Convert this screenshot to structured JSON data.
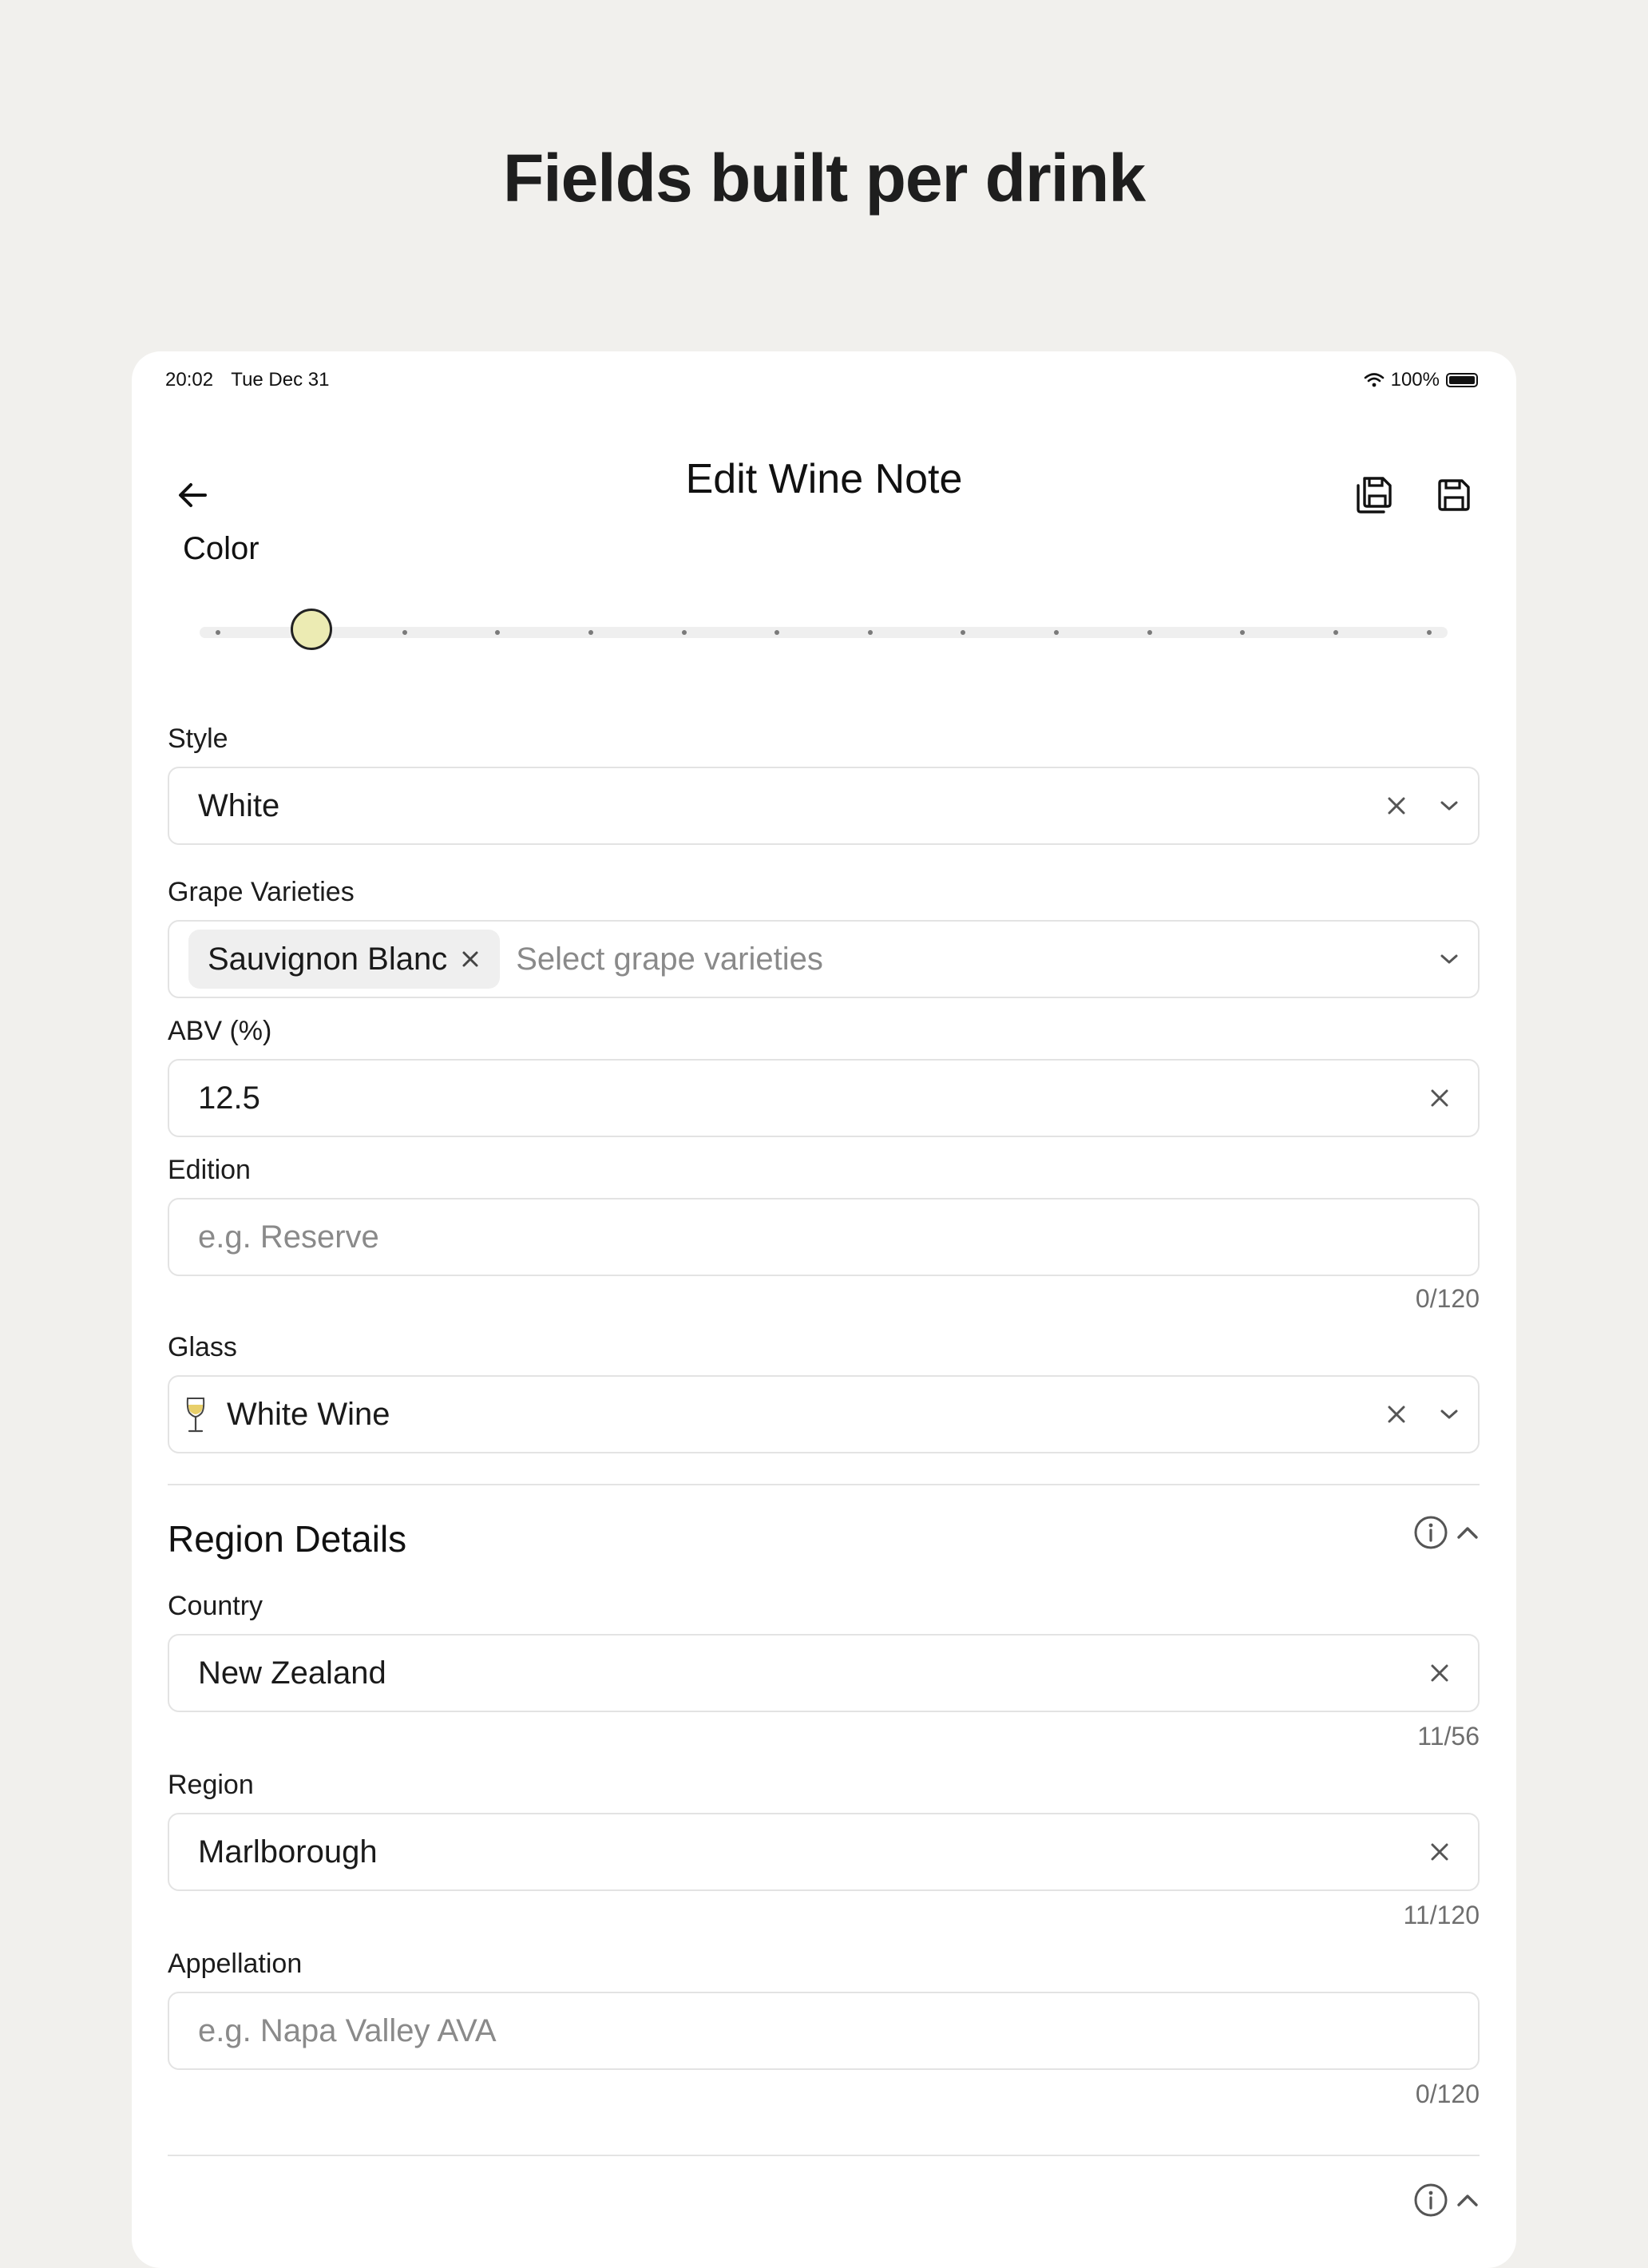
{
  "page": {
    "headline": "Fields built per drink"
  },
  "status_bar": {
    "time": "20:02",
    "date": "Tue Dec 31",
    "battery": "100%"
  },
  "nav": {
    "title": "Edit Wine Note"
  },
  "color": {
    "label": "Color",
    "steps": 14,
    "selected_index": 1,
    "selected_swatch": "#ecebb3"
  },
  "form": {
    "style": {
      "label": "Style",
      "value": "White"
    },
    "grapes": {
      "label": "Grape Varieties",
      "chips": [
        "Sauvignon Blanc"
      ],
      "placeholder": "Select grape varieties"
    },
    "abv": {
      "label": "ABV (%)",
      "value": "12.5"
    },
    "edition": {
      "label": "Edition",
      "placeholder": "e.g. Reserve",
      "counter": "0/120"
    },
    "glass": {
      "label": "Glass",
      "value": "White Wine"
    }
  },
  "region": {
    "title": "Region Details",
    "country": {
      "label": "Country",
      "value": "New Zealand",
      "counter": "11/56"
    },
    "region": {
      "label": "Region",
      "value": "Marlborough",
      "counter": "11/120"
    },
    "appellation": {
      "label": "Appellation",
      "placeholder": "e.g. Napa Valley AVA",
      "counter": "0/120"
    }
  },
  "icons": {
    "back": "arrow-left-icon",
    "save_as": "save-copy-icon",
    "save": "save-icon",
    "clear": "close-icon",
    "dropdown": "chevron-down-icon",
    "glass": "wine-glass-icon",
    "info": "info-icon",
    "collapse": "chevron-up-icon"
  }
}
